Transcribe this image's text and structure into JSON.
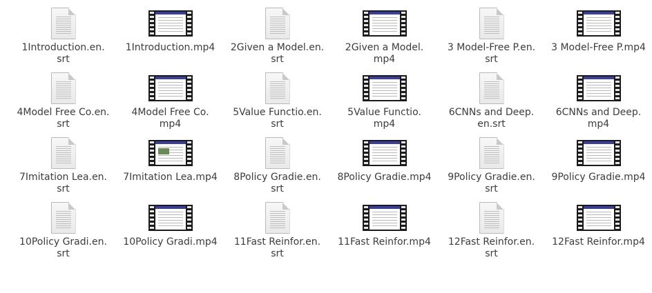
{
  "files": [
    {
      "name": "1Introduction.en.\nsrt",
      "kind": "subtitle",
      "icon": "text-document-icon"
    },
    {
      "name": "1Introduction.mp4",
      "kind": "video",
      "icon": "video-file-icon"
    },
    {
      "name": "2Given a Model.en.\nsrt",
      "kind": "subtitle",
      "icon": "text-document-icon"
    },
    {
      "name": "2Given a Model.\nmp4",
      "kind": "video",
      "icon": "video-file-icon"
    },
    {
      "name": "3 Model-Free P.en.\nsrt",
      "kind": "subtitle",
      "icon": "text-document-icon"
    },
    {
      "name": "3 Model-Free P.mp4",
      "kind": "video",
      "icon": "video-file-icon"
    },
    {
      "name": "4Model Free Co.en.\nsrt",
      "kind": "subtitle",
      "icon": "text-document-icon"
    },
    {
      "name": "4Model Free Co.\nmp4",
      "kind": "video",
      "icon": "video-file-icon"
    },
    {
      "name": "5Value Functio.en.\nsrt",
      "kind": "subtitle",
      "icon": "text-document-icon"
    },
    {
      "name": "5Value Functio.\nmp4",
      "kind": "video",
      "icon": "video-file-icon"
    },
    {
      "name": "6CNNs and Deep.\nen.srt",
      "kind": "subtitle",
      "icon": "text-document-icon"
    },
    {
      "name": "6CNNs and Deep.\nmp4",
      "kind": "video",
      "icon": "video-file-icon"
    },
    {
      "name": "7Imitation Lea.en.\nsrt",
      "kind": "subtitle",
      "icon": "text-document-icon"
    },
    {
      "name": "7Imitation Lea.mp4",
      "kind": "video",
      "icon": "video-file-icon"
    },
    {
      "name": "8Policy Gradie.en.\nsrt",
      "kind": "subtitle",
      "icon": "text-document-icon"
    },
    {
      "name": "8Policy Gradie.mp4",
      "kind": "video",
      "icon": "video-file-icon"
    },
    {
      "name": "9Policy Gradie.en.\nsrt",
      "kind": "subtitle",
      "icon": "text-document-icon"
    },
    {
      "name": "9Policy Gradie.mp4",
      "kind": "video",
      "icon": "video-file-icon"
    },
    {
      "name": "10Policy Gradi.en.\nsrt",
      "kind": "subtitle",
      "icon": "text-document-icon"
    },
    {
      "name": "10Policy Gradi.mp4",
      "kind": "video",
      "icon": "video-file-icon"
    },
    {
      "name": "11Fast Reinfor.en.\nsrt",
      "kind": "subtitle",
      "icon": "text-document-icon"
    },
    {
      "name": "11Fast Reinfor.mp4",
      "kind": "video",
      "icon": "video-file-icon"
    },
    {
      "name": "12Fast Reinfor.en.\nsrt",
      "kind": "subtitle",
      "icon": "text-document-icon"
    },
    {
      "name": "12Fast Reinfor.mp4",
      "kind": "video",
      "icon": "video-file-icon"
    }
  ],
  "colors": {
    "label_text": "#3c3c3c",
    "slide_header": "#3a3f9a",
    "film_strip": "#1a1a1a"
  }
}
